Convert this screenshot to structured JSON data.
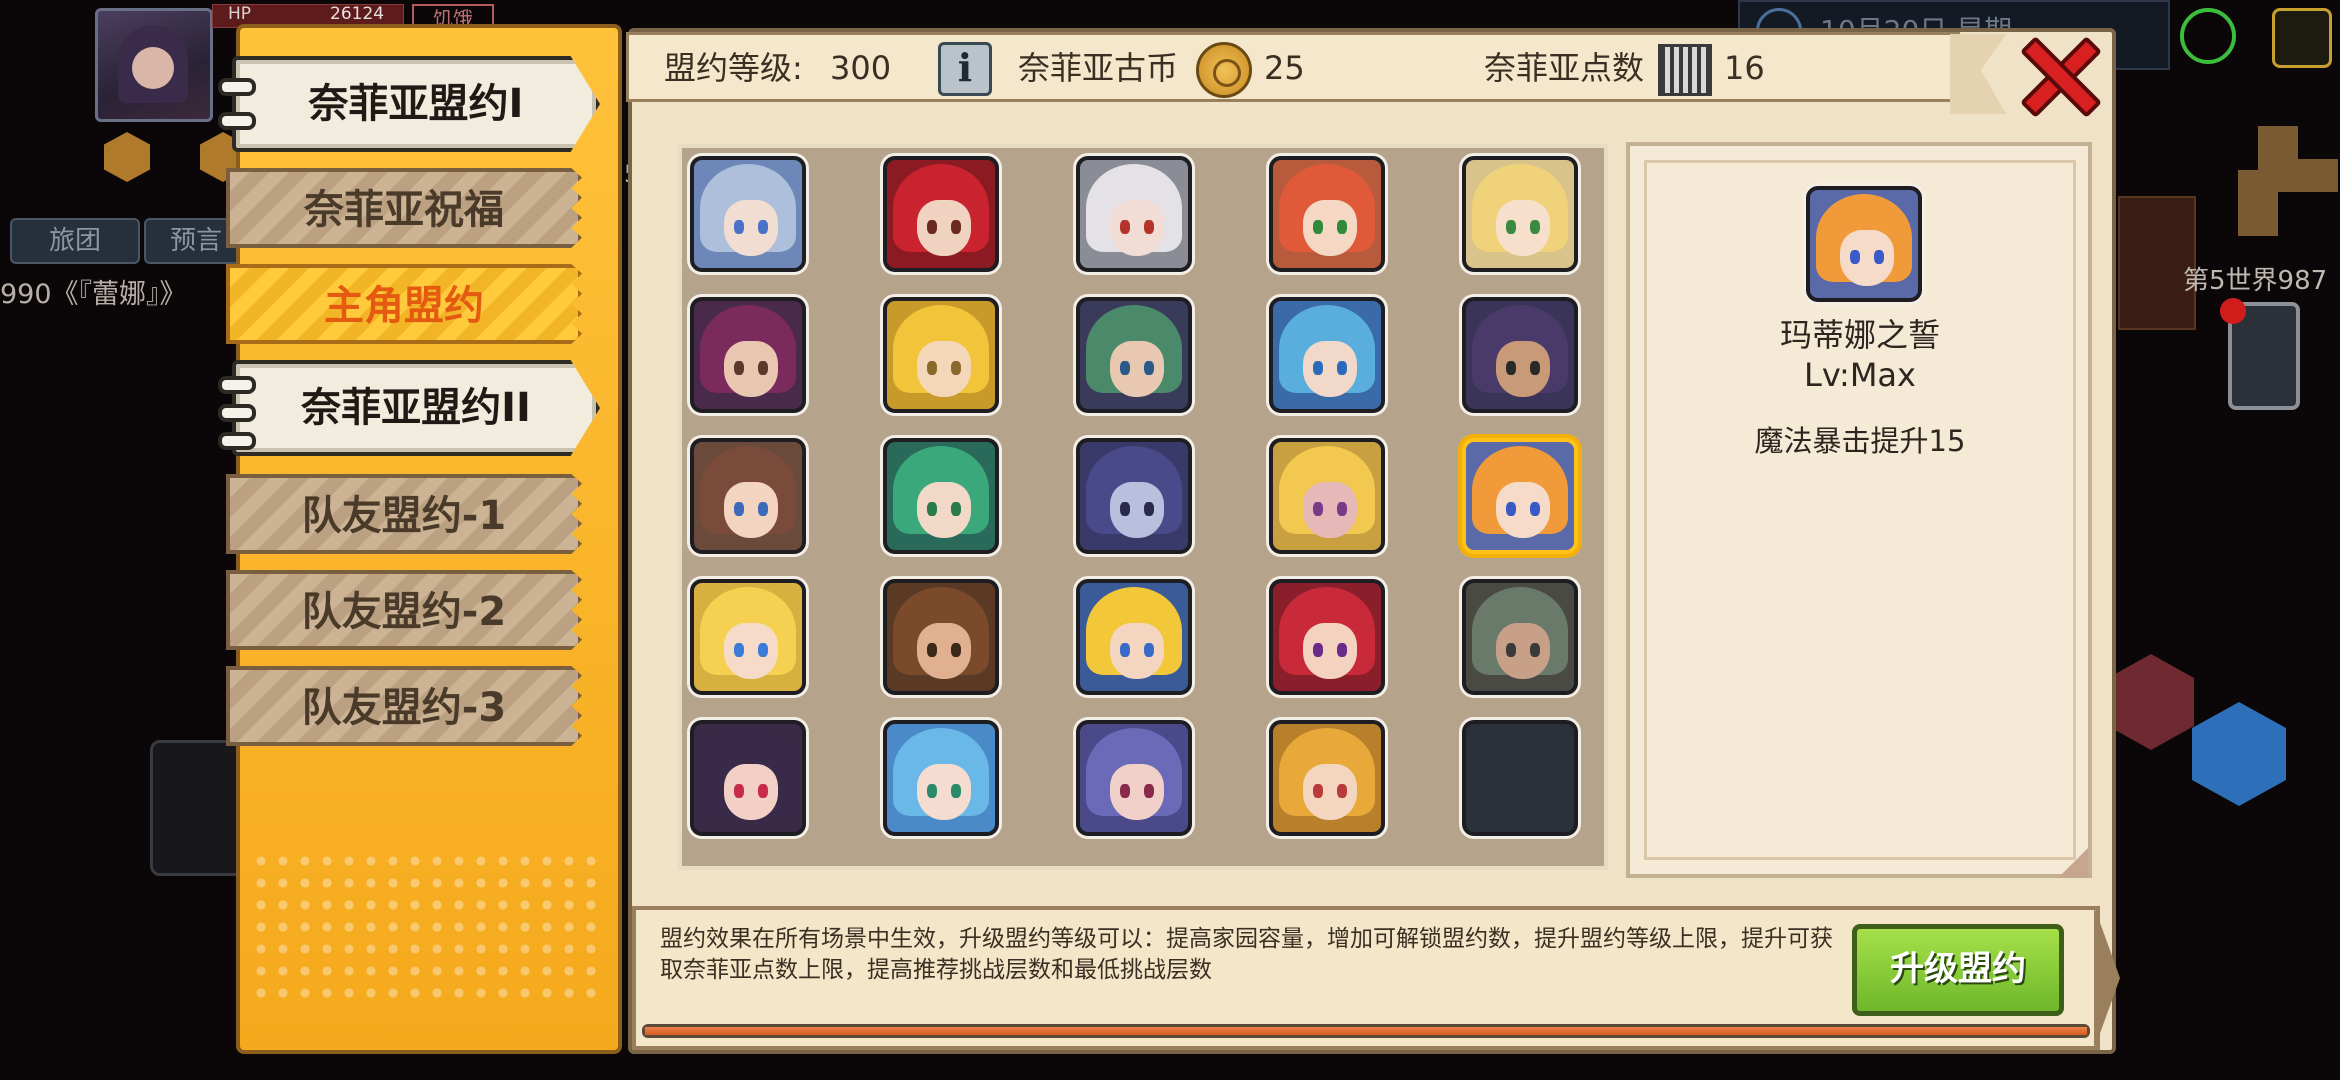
{
  "background": {
    "hp_label": "HP",
    "hp_value": "26124",
    "status_text": "饥饿",
    "buttons": [
      "旅团",
      "预言"
    ],
    "chat_text": "990《『蕾娜』》",
    "side_label_digit": "5",
    "datetime_text": "10月20日 星期",
    "world_label": "第5世界987"
  },
  "tabs": [
    {
      "label": "奈菲亚盟约I",
      "style": "scroll"
    },
    {
      "label": "奈菲亚祝福",
      "style": "plain"
    },
    {
      "label": "主角盟约",
      "style": "highlight"
    },
    {
      "label": "奈菲亚盟约II",
      "style": "scroll"
    },
    {
      "label": "队友盟约-1",
      "style": "plain"
    },
    {
      "label": "队友盟约-2",
      "style": "plain"
    },
    {
      "label": "队友盟约-3",
      "style": "plain"
    }
  ],
  "topbar": {
    "level_label": "盟约等级:",
    "level_value": "300",
    "coin_label": "奈菲亚古币",
    "coin_value": "25",
    "points_label": "奈菲亚点数",
    "points_value": "16",
    "info_icon": "info-icon",
    "close_icon": "close-icon"
  },
  "grid": {
    "rows": 5,
    "cols": 5,
    "selected_index": 14,
    "portraits": [
      {
        "hair": "#aebfdc",
        "skin": "#f2ddd2",
        "eye": "#4a72c8",
        "bg": "#6d87b8"
      },
      {
        "hair": "#c8232e",
        "skin": "#f0d2c0",
        "eye": "#6a2a22",
        "bg": "#8c1a22"
      },
      {
        "hair": "#e4e2e6",
        "skin": "#f1ddd5",
        "eye": "#b4342c",
        "bg": "#8a8c96"
      },
      {
        "hair": "#e05a3a",
        "skin": "#f4d8c4",
        "eye": "#2f8a3a",
        "bg": "#b85a3c"
      },
      {
        "hair": "#f0d27a",
        "skin": "#f6e0cc",
        "eye": "#3a8a42",
        "bg": "#d8c48a"
      },
      {
        "hair": "#7a2a5c",
        "skin": "#e8c6b0",
        "eye": "#5a3a2a",
        "bg": "#4a2a4a"
      },
      {
        "hair": "#f2c43a",
        "skin": "#f4d6b8",
        "eye": "#8a6a2a",
        "bg": "#c89a2a"
      },
      {
        "hair": "#4a8a6a",
        "skin": "#e8c8b0",
        "eye": "#2a5a8a",
        "bg": "#3a3a5a"
      },
      {
        "hair": "#5aaede",
        "skin": "#f2d8c8",
        "eye": "#2a6ab8",
        "bg": "#3a6aa8"
      },
      {
        "hair": "#4a3a6a",
        "skin": "#c89a78",
        "eye": "#2a2a2a",
        "bg": "#3a3458"
      },
      {
        "hair": "#7a4a3a",
        "skin": "#f2d4c0",
        "eye": "#3a6ab8",
        "bg": "#6a4a3a"
      },
      {
        "hair": "#3aa87a",
        "skin": "#f2d8c6",
        "eye": "#2a7a4a",
        "bg": "#2a6a5a"
      },
      {
        "hair": "#4a4a8a",
        "skin": "#b8c0de",
        "eye": "#2a2a4a",
        "bg": "#3a3a6a"
      },
      {
        "hair": "#f2c850",
        "skin": "#e6b8b8",
        "eye": "#7a3a8a",
        "bg": "#c8a040"
      },
      {
        "hair": "#f09a3a",
        "skin": "#f6dcc8",
        "eye": "#3a5ac8",
        "bg": "#5a6aa8"
      },
      {
        "hair": "#f6d050",
        "skin": "#f6dcc8",
        "eye": "#3a7ad8",
        "bg": "#d8b040"
      },
      {
        "hair": "#7a4a2a",
        "skin": "#e0b090",
        "eye": "#3a2a1a",
        "bg": "#5a3a24"
      },
      {
        "hair": "#f2c83a",
        "skin": "#f4d6c0",
        "eye": "#3a6ac8",
        "bg": "#3a5a98"
      },
      {
        "hair": "#c82a3a",
        "skin": "#f4d2c0",
        "eye": "#6a2a8a",
        "bg": "#8a1e2a"
      },
      {
        "hair": "#6a7a6a",
        "skin": "#c8a088",
        "eye": "#3a3a3a",
        "bg": "#4a4a44"
      },
      {
        "hair": "#3a2a4a",
        "skin": "#f2d0c6",
        "eye": "#c82a4a",
        "bg": "#3a2a48"
      },
      {
        "hair": "#6ab8e8",
        "skin": "#f4dcd0",
        "eye": "#2a8a6a",
        "bg": "#4a8ac8"
      },
      {
        "hair": "#6a6ab8",
        "skin": "#f0d0c8",
        "eye": "#8a2a4a",
        "bg": "#4a4a8a"
      },
      {
        "hair": "#e8a83a",
        "skin": "#f4d6c0",
        "eye": "#b83a3a",
        "bg": "#b8802a"
      },
      {
        "hair": null,
        "skin": null,
        "eye": null,
        "bg": "#2b313b"
      }
    ]
  },
  "detail": {
    "name": "玛蒂娜之誓",
    "level": "Lv:Max",
    "effect": "魔法暴击提升15"
  },
  "footer": {
    "description": "盟约效果在所有场景中生效，升级盟约等级可以：提高家园容量，增加可解锁盟约数，提升盟约等级上限，提升可获取奈菲亚点数上限，提高推荐挑战层数和最低挑战层数",
    "upgrade_label": "升级盟约",
    "progress": 1.0
  },
  "colors": {
    "tab_panel": "#ffc23a",
    "highlight_text": "#e45a10",
    "close_red": "#d82020",
    "upgrade_green": "#8ccc3a",
    "progress_orange": "#e0703a"
  }
}
